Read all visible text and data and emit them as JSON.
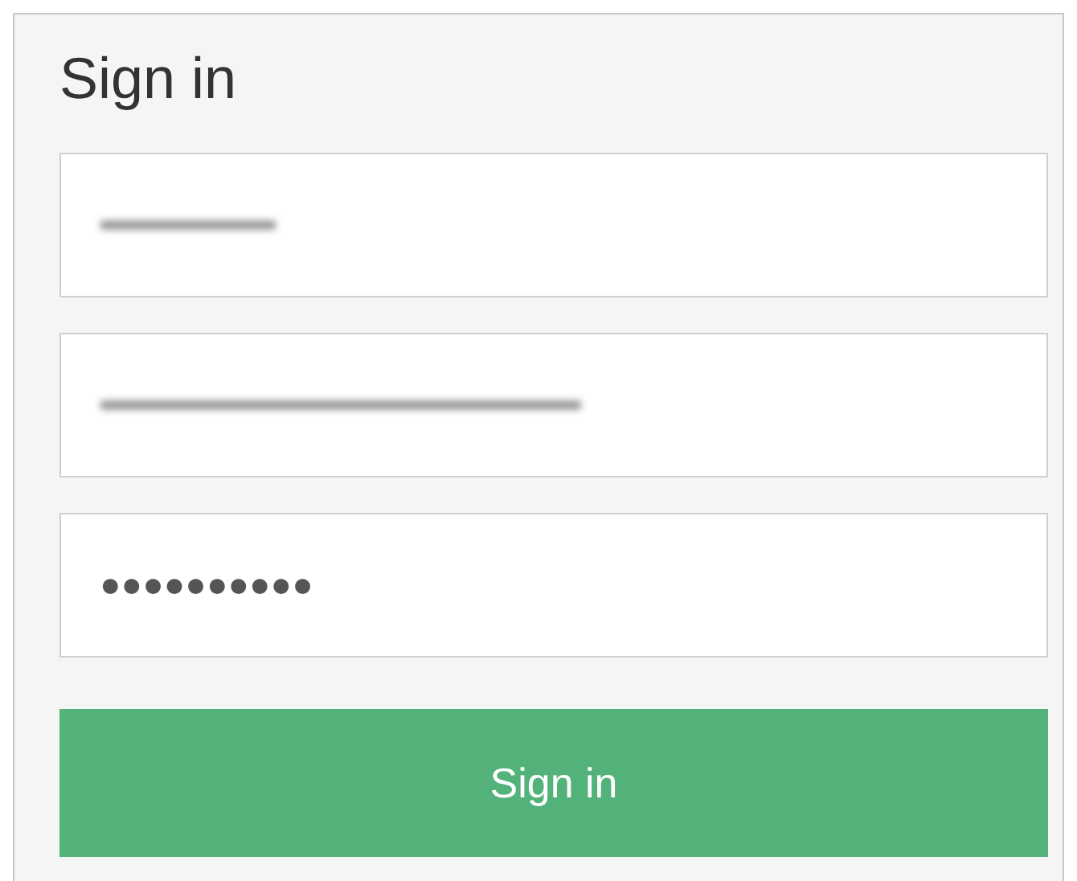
{
  "title": "Sign in",
  "fields": [
    {
      "kind": "redacted"
    },
    {
      "kind": "redacted"
    },
    {
      "kind": "password",
      "value": "●●●●●●●●●●"
    }
  ],
  "button": "Sign in"
}
